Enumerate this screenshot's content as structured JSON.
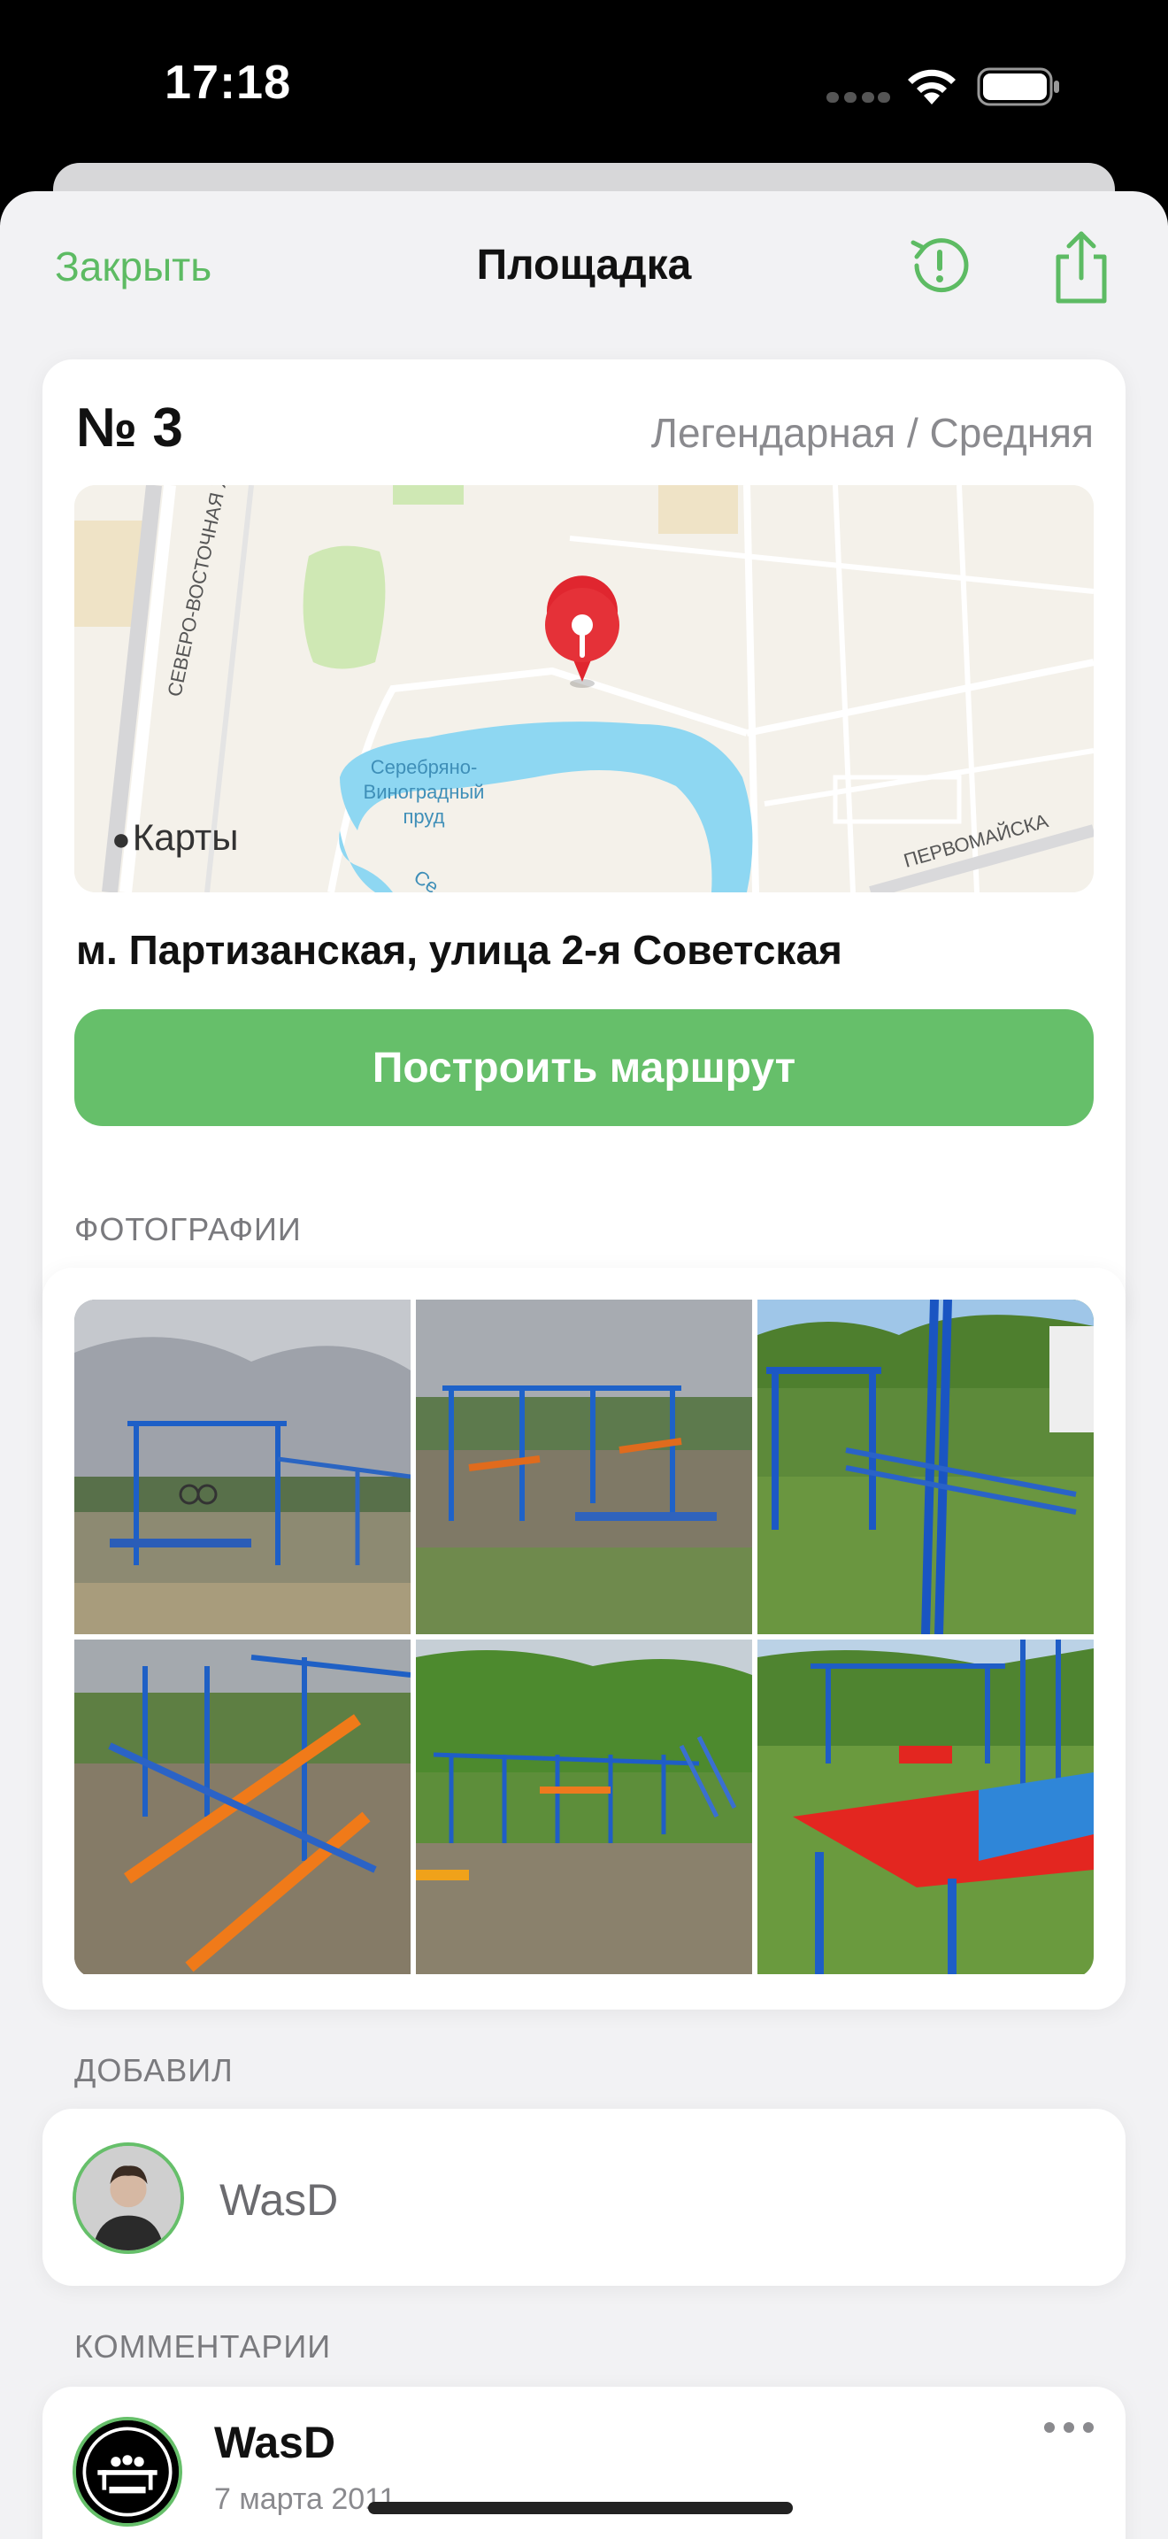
{
  "status": {
    "time": "17:18"
  },
  "nav": {
    "close_label": "Закрыть",
    "title": "Площадка",
    "history_icon": "history-alert-icon",
    "share_icon": "share-icon"
  },
  "park": {
    "number": "№ 3",
    "meta": "Легендарная / Средняя",
    "address": "м. Партизанская, улица 2-я Советская",
    "route_label": "Построить маршрут"
  },
  "map": {
    "logo_text": "Карты",
    "labels": {
      "road": "СЕВЕРО-ВОСТОЧНАЯ ХОРДА",
      "pond_1": "Серебряно-",
      "pond_2": "Виноградный",
      "pond_3": "пруд",
      "street": "ПЕРВОМАЙСКА",
      "partial": "Се"
    }
  },
  "photos": {
    "title": "ФОТОГРАФИИ",
    "items": [
      "photo-1",
      "photo-2",
      "photo-3",
      "photo-4",
      "photo-5",
      "photo-6"
    ]
  },
  "author": {
    "title": "ДОБАВИЛ",
    "name": "WasD"
  },
  "comments": {
    "title": "КОММЕНТАРИИ",
    "items": [
      {
        "user": "WasD",
        "date": "7 марта 2011"
      }
    ]
  },
  "colors": {
    "accent": "#5dbb63",
    "button": "#66bf6a",
    "background": "#f2f2f4"
  }
}
